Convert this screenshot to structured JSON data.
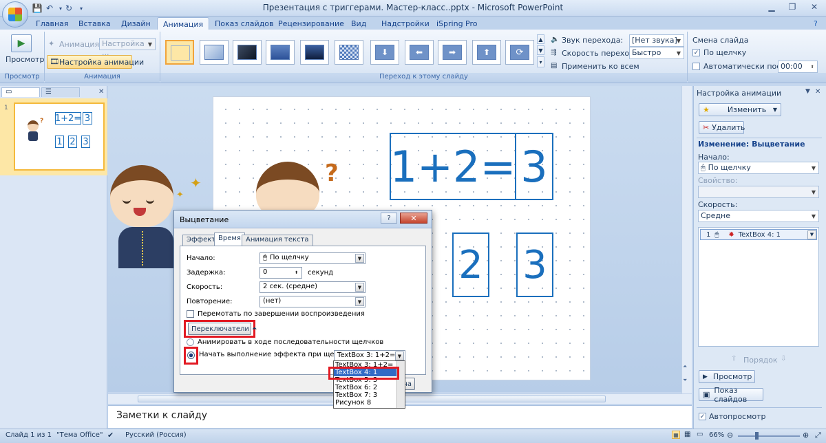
{
  "app": {
    "title": "Презентация с триггерами. Мастер-класс..pptx - Microsoft PowerPoint"
  },
  "ribbon": {
    "tabs": [
      "Главная",
      "Вставка",
      "Дизайн",
      "Анимация",
      "Показ слайдов",
      "Рецензирование",
      "Вид",
      "Надстройки",
      "iSpring Pro"
    ],
    "active_tab": "Анимация",
    "preview_label": "Просмотр",
    "groups": {
      "preview": "Просмотр",
      "animation": "Анимация",
      "transition": "Переход к этому слайду"
    },
    "animation_label": "Анимация:",
    "animation_value": "Настройка ...",
    "custom_animation": "Настройка анимации",
    "transition_sound_label": "Звук перехода:",
    "transition_sound_value": "[Нет звука]",
    "transition_speed_label": "Скорость перехода:",
    "transition_speed_value": "Быстро",
    "apply_all": "Применить ко всем",
    "advance_header": "Смена слайда",
    "on_click": "По щелчку",
    "auto_after": "Автоматически после:",
    "auto_time": "00:00"
  },
  "slide": {
    "equation": "1+2=",
    "answer": "3",
    "options": [
      "1",
      "2",
      "3"
    ]
  },
  "notes": {
    "placeholder": "Заметки к слайду"
  },
  "taskpane": {
    "title": "Настройка анимации",
    "change_btn": "Изменить",
    "delete_btn": "Удалить",
    "change_header": "Изменение: Выцветание",
    "start_label": "Начало:",
    "start_value": "По щелчку",
    "property_label": "Свойство:",
    "speed_label": "Скорость:",
    "speed_value": "Средне",
    "list_item_num": "1",
    "list_item_label": "TextBox 4: 1",
    "order_label": "Порядок",
    "play_btn": "Просмотр",
    "slideshow_btn": "Показ слайдов",
    "autopreview": "Автопросмотр"
  },
  "dialog": {
    "title": "Выцветание",
    "tabs": [
      "Эффект",
      "Время",
      "Анимация текста"
    ],
    "active_tab": "Время",
    "start_label": "Начало:",
    "start_value": "По щелчку",
    "delay_label": "Задержка:",
    "delay_value": "0",
    "delay_unit": "секунд",
    "speed_label": "Скорость:",
    "speed_value": "2 сек. (средне)",
    "repeat_label": "Повторение:",
    "repeat_value": "(нет)",
    "rewind_label": "Перемотать по завершении воспроизведения",
    "triggers_btn": "Переключатели",
    "animate_sequence": "Анимировать в ходе последовательности щелчков",
    "start_on_click": "Начать выполнение эффекта при щелчке",
    "trigger_value": "TextBox 3: 1+2=",
    "cancel_partial": "на",
    "dropdown_items": [
      "TextBox 3: 1+2=",
      "TextBox 4: 1",
      "TextBox 5: 3",
      "TextBox 6: 2",
      "TextBox 7: 3",
      "Рисунок 8"
    ],
    "dropdown_selected": 1
  },
  "statusbar": {
    "slide_info": "Слайд 1 из 1",
    "theme": "\"Тема Office\"",
    "language": "Русский (Россия)",
    "zoom": "66%"
  },
  "colors": {
    "accent_blue": "#1a6fbd",
    "highlight_red": "#e21a23",
    "selection_orange": "#f4b93c"
  }
}
